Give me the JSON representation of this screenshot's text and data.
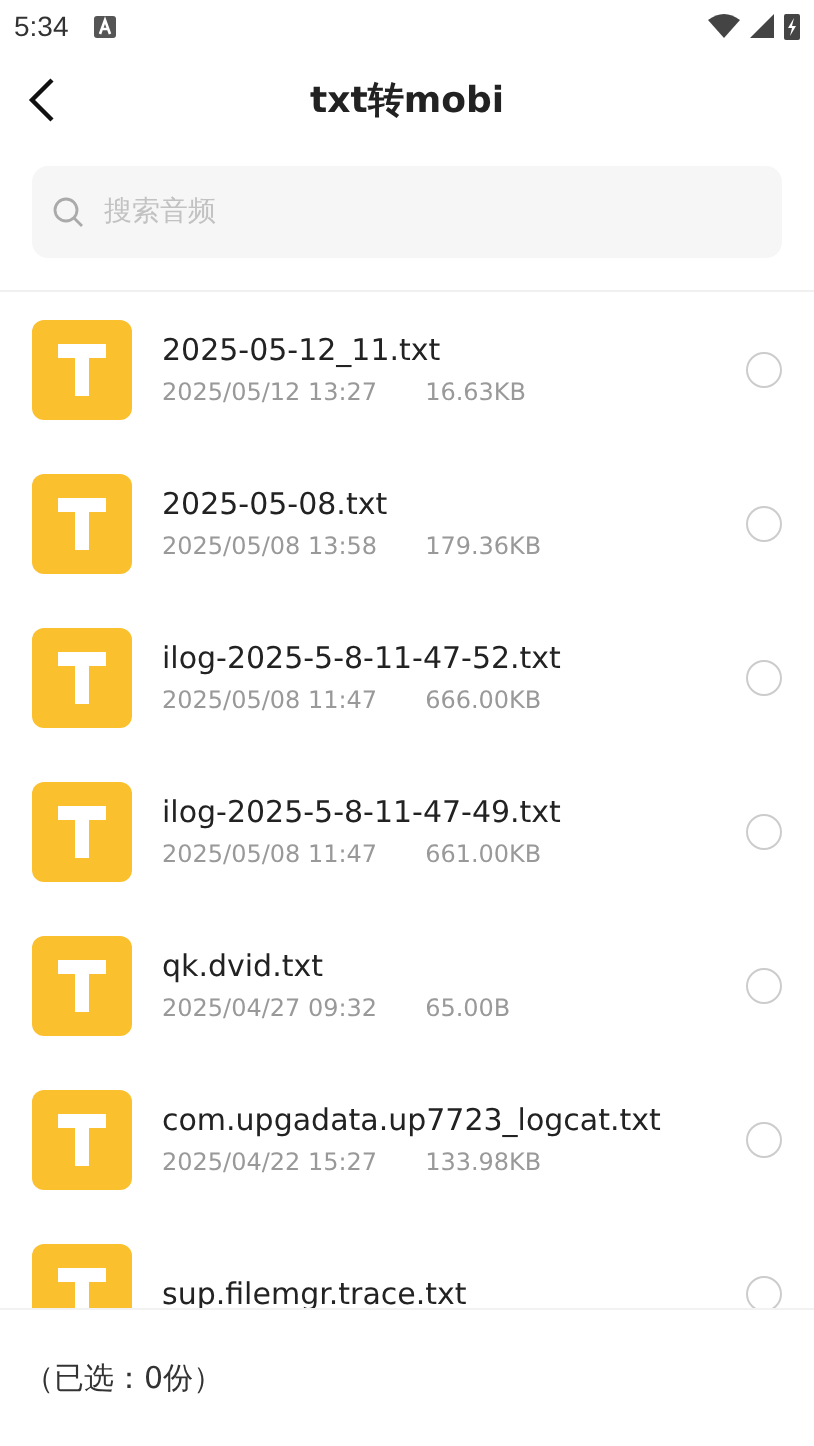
{
  "status_bar": {
    "time": "5:34"
  },
  "header": {
    "title": "txt转mobi"
  },
  "search": {
    "placeholder": "搜索音频"
  },
  "files": [
    {
      "name": "2025-05-12_11.txt",
      "date": "2025/05/12 13:27",
      "size": "16.63KB",
      "selected": false
    },
    {
      "name": "2025-05-08.txt",
      "date": "2025/05/08 13:58",
      "size": "179.36KB",
      "selected": false
    },
    {
      "name": "ilog-2025-5-8-11-47-52.txt",
      "date": "2025/05/08 11:47",
      "size": "666.00KB",
      "selected": false
    },
    {
      "name": "ilog-2025-5-8-11-47-49.txt",
      "date": "2025/05/08 11:47",
      "size": "661.00KB",
      "selected": false
    },
    {
      "name": "qk.dvid.txt",
      "date": "2025/04/27 09:32",
      "size": "65.00B",
      "selected": false
    },
    {
      "name": "com.upgadata.up7723_logcat.txt",
      "date": "2025/04/22 15:27",
      "size": "133.98KB",
      "selected": false
    },
    {
      "name": "sup.filemgr.trace.txt",
      "selected": false
    }
  ],
  "footer": {
    "selection_count": "（已选：0份）"
  }
}
